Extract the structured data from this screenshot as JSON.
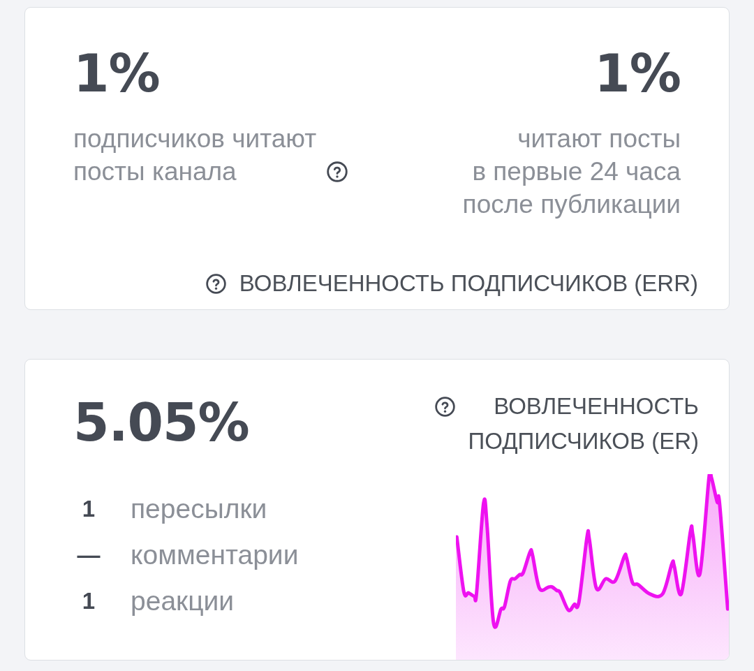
{
  "cards": [
    {
      "kind": "err",
      "stats": [
        {
          "value": "1%",
          "description": "подписчиков читают посты канала",
          "help": true
        },
        {
          "value": "1%",
          "description": "читают посты\nв первые 24 часа\nпосле публикации"
        }
      ],
      "title": "ВОВЛЕЧЕННОСТЬ ПОДПИСЧИКОВ (ERR)"
    },
    {
      "kind": "er",
      "value": "5.05%",
      "title": "ВОВЛЕЧЕННОСТЬ ПОДПИСЧИКОВ (ER)",
      "metrics": [
        {
          "value": "1",
          "label": "пересылки"
        },
        {
          "value": "—",
          "label": "комментарии"
        },
        {
          "value": "1",
          "label": "реакции"
        }
      ]
    }
  ]
}
